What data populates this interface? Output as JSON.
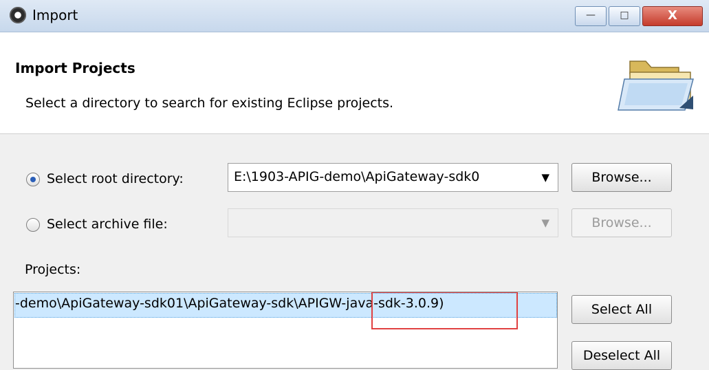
{
  "window": {
    "title": "Import",
    "controls": {
      "minimize": "—",
      "maximize": "□",
      "close": "X"
    }
  },
  "header": {
    "title": "Import Projects",
    "description": "Select a directory to search for existing Eclipse projects.",
    "icon": "folder-icon"
  },
  "root_option": {
    "label": "Select root directory:",
    "selected": true,
    "value": "E:\\1903-APIG-demo\\ApiGateway-sdk0",
    "browse_label": "Browse..."
  },
  "archive_option": {
    "label": "Select archive file:",
    "selected": false,
    "value": "",
    "browse_label": "Browse..."
  },
  "projects": {
    "label": "Projects:",
    "items": [
      {
        "before": "-demo\\ApiGateway-sdk01\\ApiGateway-sdk",
        "highlight": "\\APIGW-java-sdk-",
        "after": "3.0.9)"
      }
    ],
    "select_all_label": "Select All",
    "deselect_all_label": "Deselect All"
  }
}
